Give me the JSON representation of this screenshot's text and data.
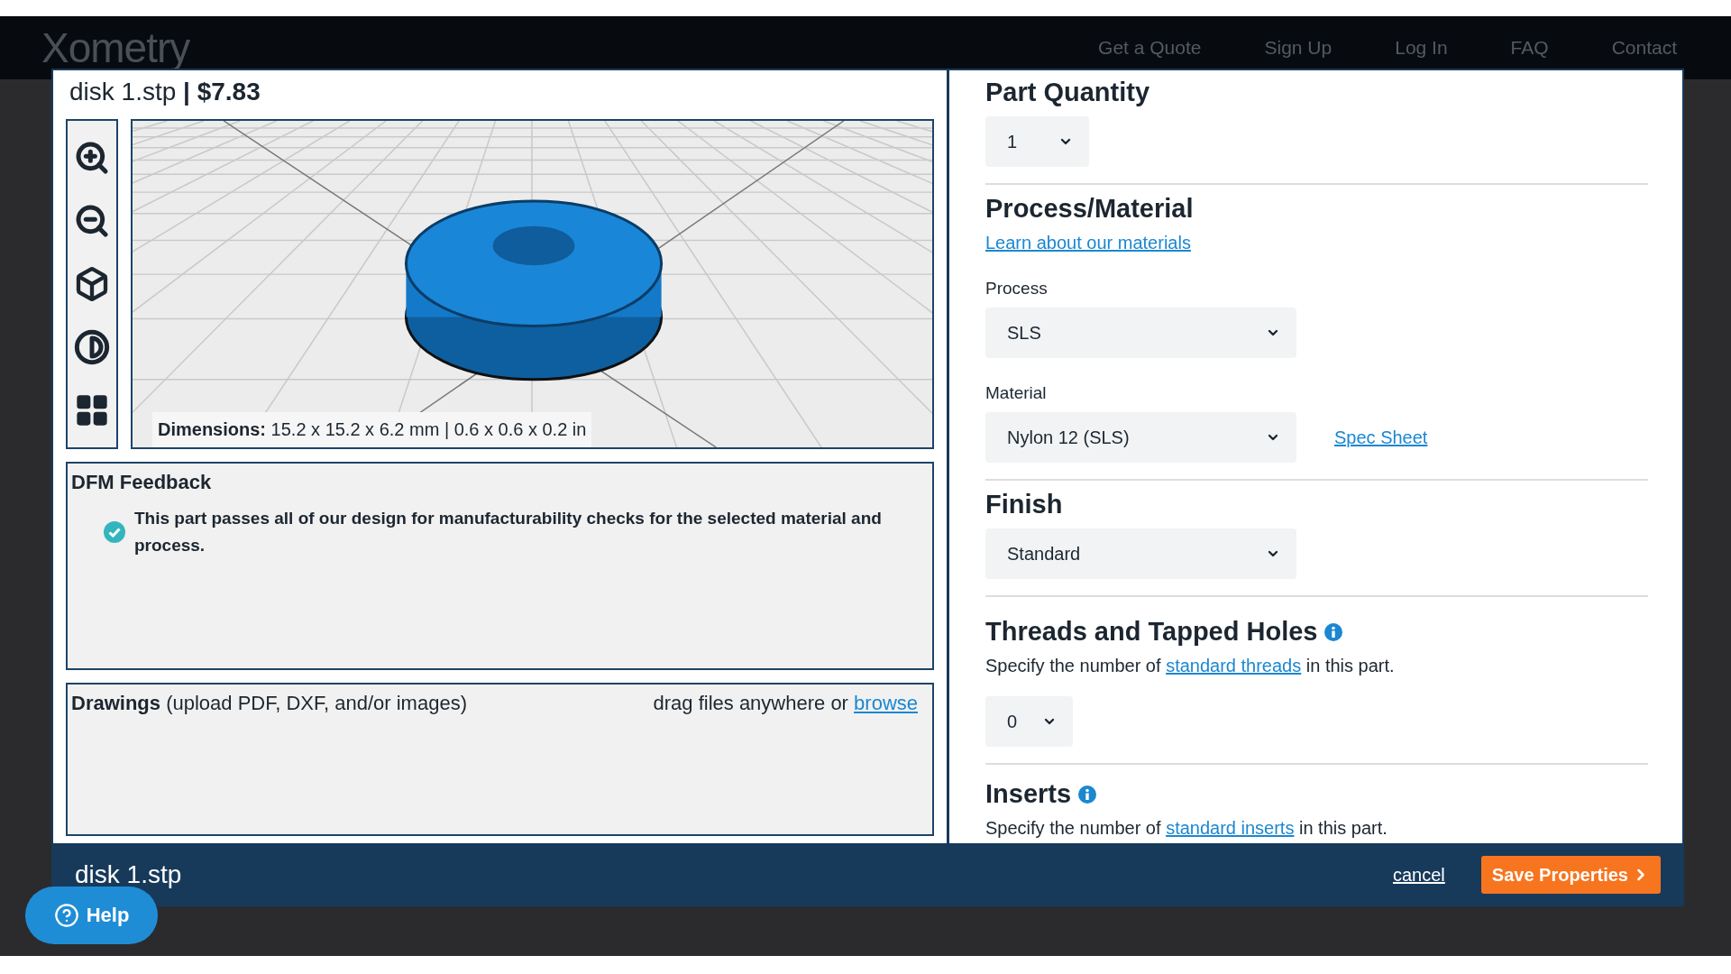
{
  "header": {
    "logo": "Xometry",
    "nav": [
      "Get a Quote",
      "Sign Up",
      "Log In",
      "FAQ",
      "Contact"
    ]
  },
  "part_title": "disk 1.stp **| $7.83**",
  "viewer": {
    "dimensions": "**Dimensions:** 15.2 x 15.2 x 6.2 mm | 0.6 x 0.6 x 0.2 in"
  },
  "dfm": {
    "title": "DFM Feedback",
    "passed": true,
    "message": "This part passes all of our design for manufacturability checks for the selected material and process."
  },
  "drawings": {
    "label": "**Drawings** (upload PDF, DXF, and/or images)",
    "hint": "drag files anywhere or",
    "link": "browse"
  },
  "quantity": {
    "title": "Part Quantity",
    "value": "1"
  },
  "process_material": {
    "title": "Process/Material",
    "link": "Learn about our materials",
    "fields": [
      {
        "label": "Process",
        "value": "SLS"
      },
      {
        "label": "Material",
        "value": "Nylon 12 (SLS)",
        "link": "Spec Sheet"
      }
    ]
  },
  "finish": {
    "title": "Finish",
    "value": "Standard"
  },
  "threads": {
    "title": "Threads and Tapped Holes",
    "text_before": "Specify the number of",
    "link": "standard threads",
    "text_after": "in this part.",
    "value": "0"
  },
  "inserts": {
    "title": "Inserts",
    "text_before": "Specify the number of",
    "link": "standard inserts",
    "text_after": "in this part."
  },
  "footer": {
    "filename": "disk 1.stp",
    "cancel": "cancel",
    "save": "Save Properties"
  },
  "help": "Help"
}
